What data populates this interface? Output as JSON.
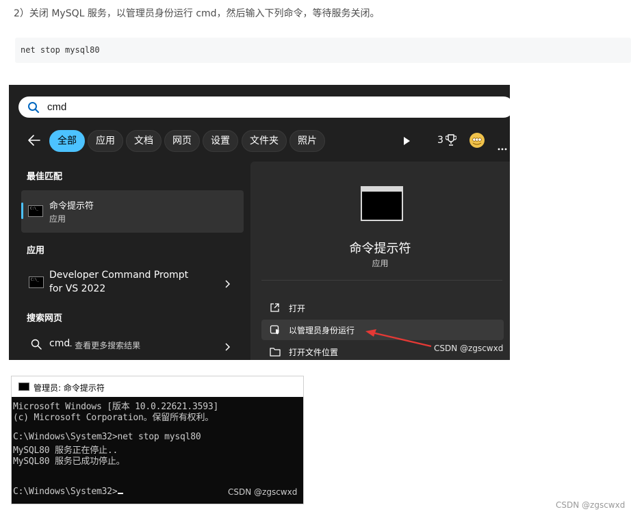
{
  "article": {
    "step_text": "2）关闭 MySQL 服务，以管理员身份运行 cmd，然后输入下列命令，等待服务关闭。",
    "code": "net stop mysql80"
  },
  "search_panel": {
    "query": "cmd",
    "tabs": [
      {
        "label": "全部",
        "active": true
      },
      {
        "label": "应用",
        "active": false
      },
      {
        "label": "文档",
        "active": false
      },
      {
        "label": "网页",
        "active": false
      },
      {
        "label": "设置",
        "active": false
      },
      {
        "label": "文件夹",
        "active": false
      },
      {
        "label": "照片",
        "active": false
      }
    ],
    "reward_count": "3",
    "best_match_heading": "最佳匹配",
    "best_match": {
      "title": "命令提示符",
      "subtitle": "应用"
    },
    "apps_heading": "应用",
    "app_item": {
      "line1": "Developer Command Prompt",
      "line2": "for VS 2022"
    },
    "web_heading": "搜索网页",
    "web_item": {
      "query": "cmd",
      "suffix": " - 查看更多搜索结果"
    },
    "detail": {
      "title": "命令提示符",
      "subtitle": "应用",
      "actions": [
        {
          "label": "打开",
          "icon": "open-external-icon"
        },
        {
          "label": "以管理员身份运行",
          "icon": "shield-icon",
          "highlighted": true
        },
        {
          "label": "打开文件位置",
          "icon": "folder-icon"
        }
      ]
    },
    "watermark": "CSDN @zgscwxd",
    "accent_color": "#4cc2ff",
    "arrow_color": "#e53935"
  },
  "console": {
    "title": "管理员: 命令提示符",
    "lines": [
      "Microsoft Windows [版本 10.0.22621.3593]",
      "(c) Microsoft Corporation。保留所有权利。",
      "",
      "C:\\Windows\\System32>net stop mysql80",
      "MySQL80 服务正在停止..",
      "MySQL80 服务已成功停止。",
      "",
      "",
      "C:\\Windows\\System32>"
    ],
    "watermark": "CSDN @zgscwxd"
  },
  "page_watermark": "CSDN @zgscwxd"
}
